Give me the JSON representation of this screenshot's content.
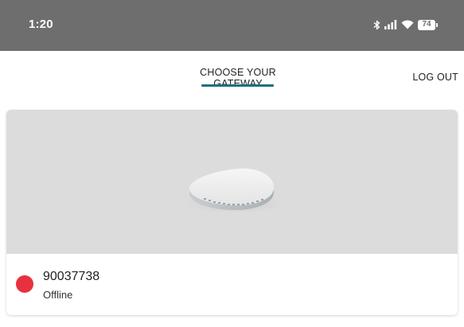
{
  "status_bar": {
    "time": "1:20",
    "icons": [
      "bluetooth-icon",
      "signal-icon",
      "wifi-icon",
      "battery-icon"
    ],
    "battery_level": "74"
  },
  "header": {
    "title": "CHOOSE YOUR GATEWAY",
    "logout_label": "LOG OUT"
  },
  "gateways": [
    {
      "id": "90037738",
      "status": "Offline",
      "status_color": "#e8313f"
    }
  ],
  "colors": {
    "accent": "#1e6f7e",
    "status_bar_bg": "#6e6e6e",
    "image_bg": "#dcdcdc"
  }
}
